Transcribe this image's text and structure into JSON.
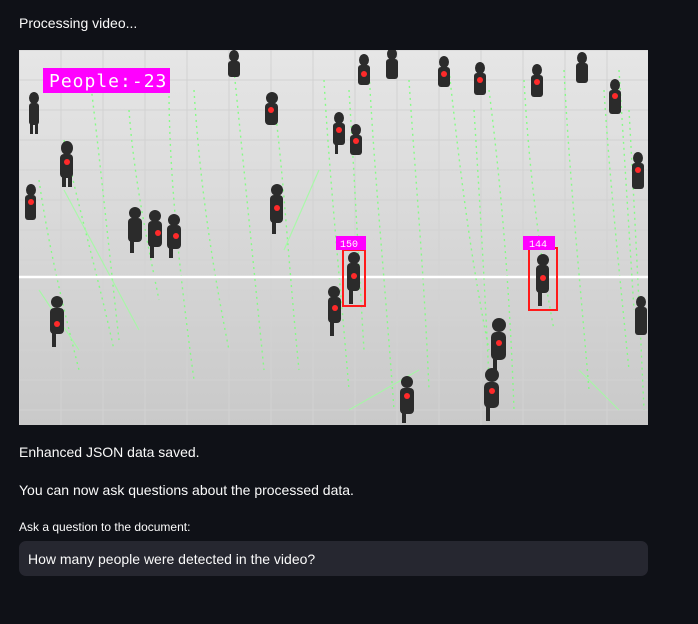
{
  "status_text": "Processing video...",
  "video_frame": {
    "overlay_count_label": "People:-23",
    "track_labels": [
      "150",
      "144"
    ],
    "colors": {
      "overlay_bg": "#ff00ff",
      "track_box": "#ff1a1a",
      "count_line": "#ffffff",
      "track_trail": "#7dff7d",
      "track_point": "#ff2a2a"
    }
  },
  "messages": {
    "saved": "Enhanced JSON data saved.",
    "ask_now": "You can now ask questions about the processed data."
  },
  "question": {
    "label": "Ask a question to the document:",
    "value": "How many people were detected in the video?"
  }
}
